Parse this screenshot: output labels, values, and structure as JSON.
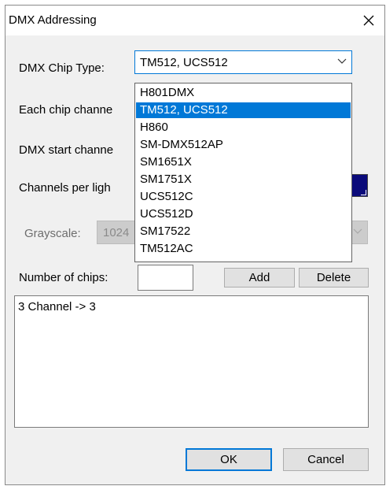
{
  "window": {
    "title": "DMX Addressing"
  },
  "form": {
    "chip_type_label": "DMX Chip Type:",
    "chip_type_value": "TM512, UCS512",
    "each_chip_label": "Each chip channe",
    "dmx_start_label": "DMX start channe",
    "channels_per_light_label": "Channels per ligh",
    "channels_color": "#0a0a7a",
    "grayscale_label": "Grayscale:",
    "grayscale_value": "1024",
    "number_of_chips_label": "Number of chips:",
    "number_of_chips_value": ""
  },
  "buttons": {
    "add": "Add",
    "delete": "Delete",
    "ok": "OK",
    "cancel": "Cancel"
  },
  "output": {
    "text": "3 Channel -> 3"
  },
  "dropdown": {
    "options": [
      "H801DMX",
      "TM512, UCS512",
      "H860",
      "SM-DMX512AP",
      "SM1651X",
      "SM1751X",
      "UCS512C",
      "UCS512D",
      "SM17522",
      "TM512AC"
    ],
    "selected": "TM512, UCS512"
  },
  "icons": {
    "close": "close-icon",
    "combo_arrow": "chevron-down-icon"
  }
}
